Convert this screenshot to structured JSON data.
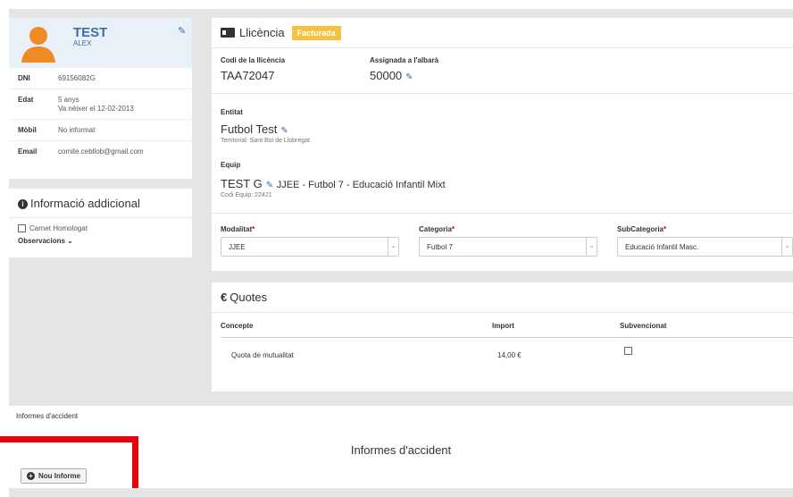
{
  "profile": {
    "name": "TEST",
    "surname": "ALEX",
    "rows": [
      {
        "key": "DNI",
        "value": "69156082G",
        "value2": ""
      },
      {
        "key": "Edat",
        "value": "5 anys",
        "value2": "Va néixer el 12-02-2013"
      },
      {
        "key": "Mòbil",
        "value": "No informat",
        "value2": ""
      },
      {
        "key": "Email",
        "value": "comite.cebllob@gmail.com",
        "value2": ""
      }
    ]
  },
  "additional": {
    "title": "Informació addicional",
    "checkbox_label": "Carnet Homologat",
    "observations": "Observacions"
  },
  "licence": {
    "title": "Llicència",
    "badge": "Facturada",
    "code_label": "Codi de la llicència",
    "code_value": "TAA72047",
    "assigned_label": "Assignada a l'albarà",
    "assigned_value": "50000",
    "entity_label": "Entitat",
    "entity_value": "Futbol Test",
    "entity_sub": "Territorial: Sant Boi de Llobregat",
    "team_label": "Equip",
    "team_prefix": "TEST G",
    "team_value": "JJEE - Futbol 7 - Educació Infantil Mixt",
    "team_sub": "Codi Equip: 22421",
    "modalitat_label": "Modalitat",
    "modalitat_value": "JJEE",
    "categoria_label": "Categoria",
    "categoria_value": "Futbol 7",
    "subcategoria_label": "SubCategoria",
    "subcategoria_value": "Educació Infantil Masc.",
    "required_mark": "*"
  },
  "quotes": {
    "title": "Quotes",
    "headers": [
      "Concepte",
      "Import",
      "Subvencionat"
    ],
    "rows": [
      {
        "concept": "Quota de mutualitat",
        "amount": "14,00 €"
      }
    ]
  },
  "tabs": {
    "accident": "Informes d'accident"
  },
  "accident": {
    "title": "Informes d'accident",
    "new_button": "Nou Informe"
  },
  "colors": {
    "accent": "#3a6ea5",
    "badge": "#f5c242",
    "highlight": "#e8000b"
  }
}
